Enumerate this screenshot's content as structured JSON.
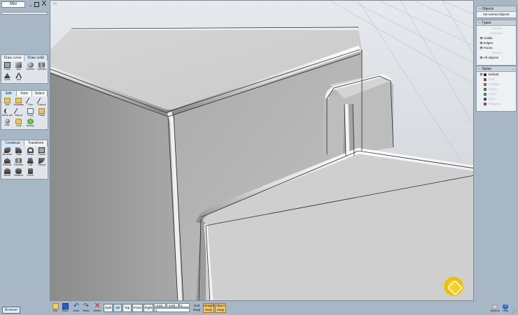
{
  "app": {
    "title": "Moi",
    "window_controls": {
      "minimize": "_",
      "close": "X"
    }
  },
  "viewport": {
    "label": "3D"
  },
  "left_panel": {
    "draw_tabs": [
      "Draw curve",
      "Draw solid"
    ],
    "draw_tools": [
      "Plane",
      "Box",
      "Sphere",
      "Cylinder",
      "Cone",
      "Text"
    ],
    "edit_tabs": [
      "Edit",
      "View",
      "Select"
    ],
    "edit_tools": [
      "Join",
      "Separate",
      "Trim",
      "Extend",
      "Show pts",
      "Add pt",
      "Copy",
      "Paste",
      "Hide",
      "Lock",
      "History"
    ],
    "construct_tabs": [
      "Construct",
      "Transform"
    ],
    "construct_tools": [
      "Boolean",
      "Fillet",
      "Offset",
      "Planar",
      "Extrude",
      "Revolve",
      "Loft",
      "Sweep",
      "Blend",
      "Network",
      "Curve"
    ],
    "browser_button": "Browser"
  },
  "right_panel": {
    "objects": {
      "header": "Objects",
      "status": "No named objects"
    },
    "types": {
      "header": "Types",
      "items": [
        {
          "label": "Curves",
          "visible": false
        },
        {
          "label": "Surfaces",
          "visible": false
        },
        {
          "label": "Solids",
          "visible": true
        },
        {
          "label": "Edges",
          "visible": true
        },
        {
          "label": "Faces",
          "visible": true
        },
        {
          "label": "Points",
          "visible": false
        },
        {
          "label": "All objects",
          "visible": true
        }
      ]
    },
    "styles": {
      "header": "Styles",
      "items": [
        {
          "label": "Default",
          "color": "#000000",
          "active": true
        },
        {
          "label": "Red",
          "color": "#e02020",
          "active": false
        },
        {
          "label": "Orange",
          "color": "#f08a10",
          "active": false
        },
        {
          "label": "Green",
          "color": "#20b020",
          "active": false
        },
        {
          "label": "Cyan",
          "color": "#20c0c0",
          "active": false
        },
        {
          "label": "Blue",
          "color": "#1030c0",
          "active": false
        },
        {
          "label": "Magenta",
          "color": "#d020d0",
          "active": false
        }
      ]
    }
  },
  "bottom_bar": {
    "file": "File",
    "save": "Save",
    "undo": "Undo",
    "redo": "Redo",
    "delete": "Delete",
    "views": [
      "Split",
      "3D",
      "Top",
      "Front",
      "Right"
    ],
    "active_view": "3D",
    "coords": {
      "x": "-8.55",
      "y": "-6.98",
      "z": "0",
      "d": "d"
    },
    "grid_snap": "Grid Snap",
    "straight_snap": "Straight Snap",
    "object_snap": "Object Snap",
    "options": "Options",
    "help": "Help"
  },
  "colors": {
    "panel_bg": "#a8b7c6",
    "viewport_bg": "#d7dbe0",
    "snap_on": "#f2c86a",
    "logo": "#f3c617"
  }
}
